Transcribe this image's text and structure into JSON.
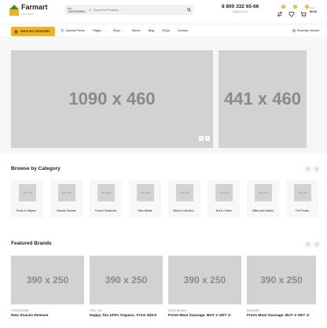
{
  "header": {
    "logo": {
      "name": "Farmart",
      "tagline": "GROCERY"
    },
    "search": {
      "category_label": "ALL CATEGORIES",
      "placeholder": "Search for Products..."
    },
    "phone": {
      "number": "8 800 332 65-66",
      "subtitle": "Support 24/7"
    },
    "compare_badge": "0",
    "wishlist_badge": "0",
    "cart_badge": "0",
    "cart": {
      "label": "Cart",
      "total": "$0.00"
    }
  },
  "nav": {
    "shop_button": "SHOP BY CATEGORY",
    "items": [
      {
        "label": "Special Prices",
        "icon": "tag-icon"
      },
      {
        "label": "Pages",
        "has_dropdown": true
      },
      {
        "label": "Shop",
        "has_dropdown": true
      },
      {
        "label": "Stores"
      },
      {
        "label": "Blog"
      },
      {
        "label": "FAQs"
      },
      {
        "label": "Contact"
      }
    ],
    "recently_viewed": "Recently Viewed"
  },
  "hero": {
    "main_banner": "1090 x 460",
    "side_banner": "441 x 460"
  },
  "categories": {
    "title": "Browse by Category",
    "items": [
      {
        "label": "Fruits & Vegeta...",
        "image": "600 x 600"
      },
      {
        "label": "Breads Sweets",
        "image": "600 x 600"
      },
      {
        "label": "Frozen Seafoods",
        "image": "600 x 600"
      },
      {
        "label": "Raw Meats",
        "image": "600 x 600"
      },
      {
        "label": "Wines & Alcohol...",
        "image": "600 x 600"
      },
      {
        "label": "Tea & Coffee",
        "image": "600 x 600"
      },
      {
        "label": "Milks and Dairies",
        "image": "600 x 600"
      },
      {
        "label": "Pet Foods",
        "image": "600 x 600"
      }
    ]
  },
  "brands": {
    "title": "Featured Brands",
    "items": [
      {
        "tag": "FOODPOUND",
        "title": "New Snacks Release",
        "image": "390 x 250"
      },
      {
        "tag": "ITEA_JSC",
        "title": "Happy Tea 100% Organic. From $29.9",
        "image": "390 x 250"
      },
      {
        "tag": "SODA BRAND",
        "title": "Fresh Meat Sausage. BUY 2 GET 1!",
        "image": "390 x 250"
      },
      {
        "tag": "FARMART",
        "title": "Fresh Meat Sausage. BUY 2 GET 1!",
        "image": "390 x 250"
      }
    ]
  },
  "colors": {
    "accent": "#f2b31c",
    "placeholder": "#d2d2d2"
  }
}
